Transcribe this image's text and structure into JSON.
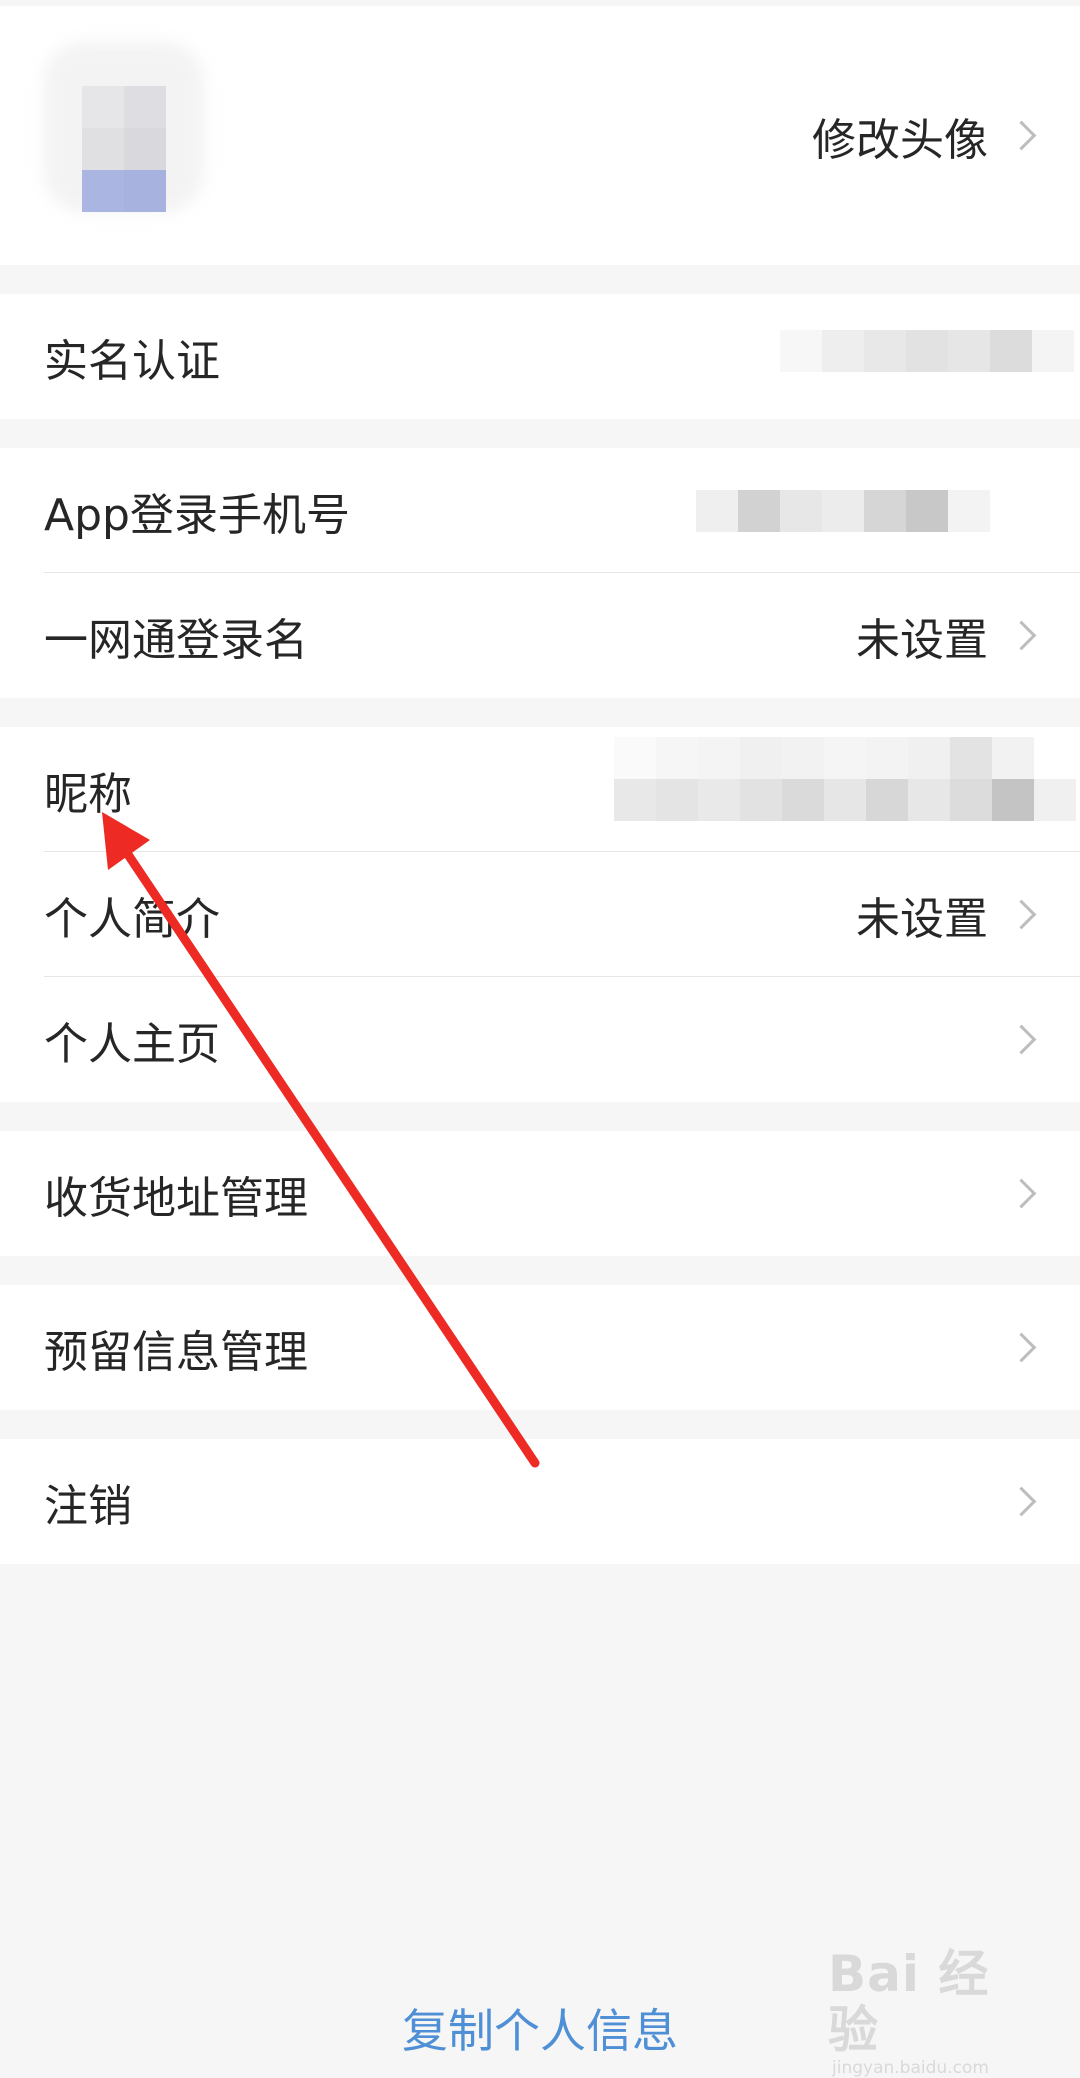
{
  "profile": {
    "change_avatar_label": "修改头像"
  },
  "rows": {
    "real_name": {
      "label": "实名认证"
    },
    "app_phone": {
      "label": "App登录手机号"
    },
    "login_name": {
      "label": "一网通登录名",
      "value": "未设置"
    },
    "nickname": {
      "label": "昵称"
    },
    "bio": {
      "label": "个人简介",
      "value": "未设置"
    },
    "homepage": {
      "label": "个人主页"
    },
    "address": {
      "label": "收货地址管理"
    },
    "reserved_info": {
      "label": "预留信息管理"
    },
    "logout": {
      "label": "注销"
    }
  },
  "footer": {
    "copy_info_label": "复制个人信息"
  },
  "watermark": {
    "brand": "Bai 经验",
    "url": "jingyan.baidu.com"
  },
  "colors": {
    "link": "#4f8fd6",
    "arrow": "#ee2a24",
    "chevron": "#bdbdbd"
  },
  "icons": {
    "chevron": "chevron-right-icon",
    "annotation": "red-arrow-annotation"
  }
}
